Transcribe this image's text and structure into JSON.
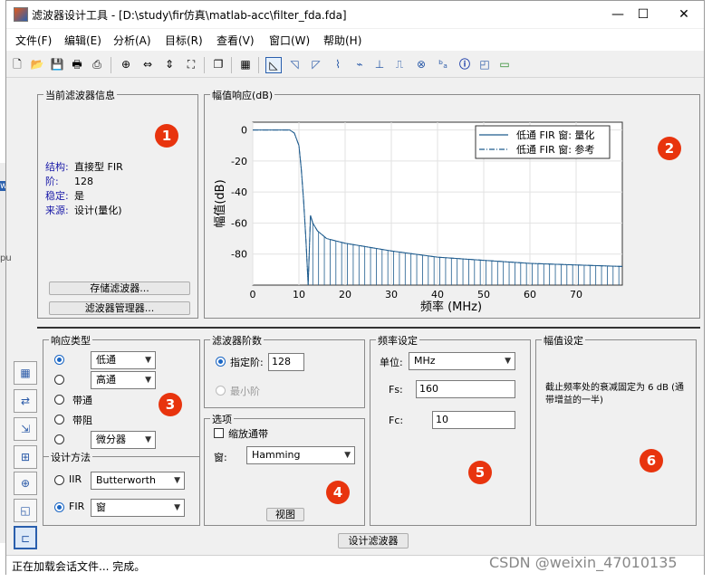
{
  "window": {
    "title": "滤波器设计工具 -  [D:\\study\\fir仿真\\matlab-acc\\filter_fda.fda]",
    "controls": {
      "minimize": "—",
      "maximize": "☐",
      "close": "✕"
    }
  },
  "menu": [
    "文件(F)",
    "编辑(E)",
    "分析(A)",
    "目标(R)",
    "查看(V)",
    "窗口(W)",
    "帮助(H)"
  ],
  "toolbar_icons": [
    "new-icon",
    "open-icon",
    "save-icon",
    "print-icon",
    "print-preview-icon",
    "zoom-in-icon",
    "zoom-x-icon",
    "zoom-y-icon",
    "full-view-icon",
    "new-window-icon",
    "filter-spec-icon",
    "magnitude-icon",
    "phase-icon",
    "mag-phase-icon",
    "group-delay-icon",
    "phase-delay-icon",
    "impulse-icon",
    "step-icon",
    "pole-zero-icon",
    "coefficients-icon",
    "info-icon",
    "cost-icon",
    "realize-icon"
  ],
  "filter_info": {
    "legend": "当前滤波器信息",
    "rows": [
      {
        "label": "结构:",
        "value": "直接型 FIR"
      },
      {
        "label": "阶:",
        "value": "128"
      },
      {
        "label": "稳定:",
        "value": "是"
      },
      {
        "label": "来源:",
        "value": "设计(量化)"
      }
    ],
    "store_button": "存储滤波器...",
    "manager_button": "滤波器管理器..."
  },
  "magnitude_plot": {
    "legend": "幅值响应(dB)",
    "ylabel": "幅值(dB)",
    "xlabel": "频率 (MHz)",
    "yticks": [
      "0",
      "-20",
      "-40",
      "-60",
      "-80"
    ],
    "xticks": [
      "0",
      "10",
      "20",
      "30",
      "40",
      "50",
      "60",
      "70"
    ],
    "series": [
      "低通 FIR 窗: 量化",
      "低通 FIR 窗: 参考"
    ]
  },
  "chart_data": {
    "type": "line",
    "xlabel": "频率 (MHz)",
    "ylabel": "幅值(dB)",
    "xlim": [
      0,
      80
    ],
    "ylim": [
      -100,
      5
    ],
    "series": [
      {
        "name": "低通 FIR 窗: 量化",
        "style": "solid",
        "x": [
          0,
          5,
          8,
          9,
          10,
          10.5,
          11,
          11.5,
          12,
          12.5,
          13,
          14,
          16,
          20,
          30,
          40,
          50,
          60,
          70,
          80
        ],
        "y": [
          0,
          0,
          0,
          -2,
          -10,
          -25,
          -45,
          -70,
          -100,
          -55,
          -60,
          -65,
          -70,
          -73,
          -78,
          -82,
          -84,
          -86,
          -87,
          -88
        ]
      },
      {
        "name": "低通 FIR 窗: 参考",
        "style": "dashdot",
        "x": [
          0,
          5,
          8,
          9,
          10,
          10.5,
          11,
          11.5,
          12,
          12.5,
          13,
          14,
          16,
          20,
          30,
          40,
          50,
          60,
          70,
          80
        ],
        "y": [
          0,
          0,
          0,
          -2,
          -10,
          -25,
          -45,
          -70,
          -100,
          -55,
          -60,
          -65,
          -70,
          -73,
          -78,
          -82,
          -84,
          -86,
          -87,
          -88
        ]
      }
    ],
    "sidelobe_floor": -100,
    "color": "#1f5c8e"
  },
  "response_type": {
    "legend": "响应类型",
    "options": [
      {
        "label": "低通",
        "select": true
      },
      {
        "label": "高通",
        "select": true
      },
      {
        "label": "带通",
        "select": false
      },
      {
        "label": "带阻",
        "select": false
      },
      {
        "label": "微分器",
        "select": true
      }
    ],
    "selected_index": 0
  },
  "design_method": {
    "legend": "设计方法",
    "iir_label": "IIR",
    "iir_value": "Butterworth",
    "fir_label": "FIR",
    "fir_value": "窗",
    "selected": "FIR"
  },
  "filter_order": {
    "legend": "滤波器阶数",
    "specify_label": "指定阶:",
    "specify_value": "128",
    "minimum_label": "最小阶"
  },
  "options": {
    "legend": "选项",
    "scale_label": "缩放通带",
    "window_label": "窗:",
    "window_value": "Hamming",
    "view_button": "视图"
  },
  "frequency": {
    "legend": "频率设定",
    "units_label": "单位:",
    "units_value": "MHz",
    "fs_label": "Fs:",
    "fs_value": "160",
    "fc_label": "Fc:",
    "fc_value": "10"
  },
  "magnitude_spec": {
    "legend": "幅值设定",
    "text": "截止频率处的衰减固定为 6 dB (通带增益的一半)"
  },
  "design_button": "设计滤波器",
  "status": "正在加载会话文件... 完成。",
  "badges": [
    "1",
    "2",
    "3",
    "4",
    "5",
    "6"
  ],
  "watermark": "CSDN @weixin_47010135",
  "side_labels": {
    "w": "w",
    "pu": "pu"
  }
}
